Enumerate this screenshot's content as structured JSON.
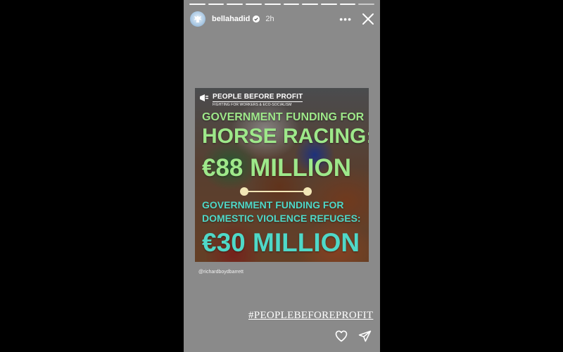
{
  "story": {
    "progress_segments": 10,
    "active_segments": 9,
    "header": {
      "username": "bellahadid",
      "verified": true,
      "time": "2h",
      "more_label": "•••",
      "avatar_icon": "angel-icon",
      "close_icon": "close-icon"
    },
    "post": {
      "brand_name": "PEOPLE BEFORE PROFIT",
      "brand_tagline": "FIGHTING FOR WORKERS & ECO-SOCIALISM",
      "line1": "GOVERNMENT FUNDING FOR",
      "line2": "HORSE RACING:",
      "amount1": "€88 MILLION",
      "line3a": "GOVERNMENT FUNDING FOR",
      "line3b": "DOMESTIC VIOLENCE REFUGES:",
      "amount2": "€30 MILLION",
      "colors": {
        "green": "#9ee88a",
        "teal": "#4fd8c8",
        "divider": "#f2e6b6"
      }
    },
    "credit": "@richardboydbarrett",
    "hashtag": "#PEOPLEBEFOREPROFIT",
    "footer_icons": [
      "heart-icon",
      "send-icon"
    ]
  }
}
